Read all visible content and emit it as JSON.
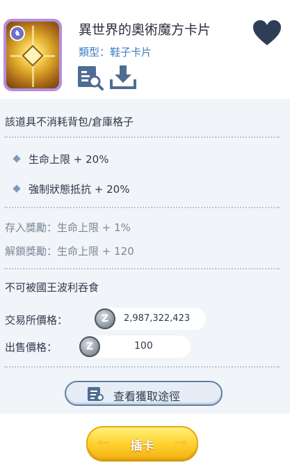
{
  "item": {
    "title": "異世界的奧術魔方卡片",
    "type_text": "類型：鞋子卡片"
  },
  "icons": {
    "favorite": "heart-icon",
    "detail": "card-detail-icon",
    "download": "download-icon",
    "card_badge": "card-type-badge-icon",
    "coin": "zeny-coin-icon",
    "source": "source-list-icon"
  },
  "colors": {
    "type_text": "#3f7dbf",
    "panel_bg": "#f1f4f8",
    "heart": "#2e3e57",
    "insert_button": "#ffd22e"
  },
  "panel": {
    "storage_note": "該道具不消耗背包/倉庫格子",
    "stats": [
      "生命上限 + 20%",
      "強制狀態抵抗 + 20%"
    ],
    "rewards": {
      "deposit": "存入獎勵：生命上限 + 1%",
      "unlock": "解鎖獎勵：生命上限 + 120"
    },
    "poring_note": "不可被國王波利吞食",
    "exchange_label": "交易所價格：",
    "exchange_price": "2,987,322,423",
    "sell_label": "出售價格：",
    "sell_price": "100",
    "source_button": "查看獲取途徑"
  },
  "insert_button": "插卡"
}
